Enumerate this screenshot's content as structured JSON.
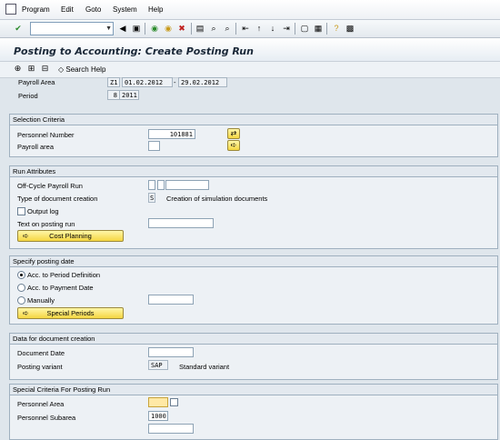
{
  "menu": {
    "items": [
      {
        "label": "Program"
      },
      {
        "label": "Edit"
      },
      {
        "label": "Goto"
      },
      {
        "label": "System"
      },
      {
        "label": "Help"
      }
    ]
  },
  "title": "Posting to Accounting: Create Posting Run",
  "app_toolbar": {
    "search_help": "Search Help"
  },
  "top_section": {
    "payroll_area_label": "Payroll Area",
    "payroll_area_value": "Z1",
    "from_date": "01.02.2012",
    "dash": "-",
    "to_date": "29.02.2012",
    "period_label": "Period",
    "period_value": "8",
    "period_year": "2011"
  },
  "selection_criteria": {
    "title": "Selection Criteria",
    "personnel_number_label": "Personnel Number",
    "personnel_number_value": "101881",
    "payroll_area_label": "Payroll area",
    "payroll_area_value": ""
  },
  "run_attributes": {
    "title": "Run Attributes",
    "off_cycle_label": "Off-Cycle Payroll Run",
    "doc_creation_label": "Type of document creation",
    "doc_creation_value": "S",
    "doc_creation_text": "Creation of simulation documents",
    "output_log_label": "Output log",
    "text_on_posting_label": "Text on posting run",
    "cost_planning_label": "Cost Planning"
  },
  "posting_date": {
    "title": "Specify posting date",
    "opt1": "Acc. to Period Definition",
    "opt2": "Acc. to Payment Date",
    "opt3": "Manually",
    "special_periods_label": "Special Periods"
  },
  "doc_creation_data": {
    "title": "Data for document creation",
    "doc_date_label": "Document Date",
    "posting_variant_label": "Posting variant",
    "posting_variant_value": "SAP",
    "posting_variant_text": "Standard variant"
  },
  "special_criteria": {
    "title": "Special Criteria For Posting Run",
    "personnel_area_label": "Personnel Area",
    "personnel_subarea_label": "Personnel Subarea",
    "personnel_subarea_value": "1000"
  }
}
